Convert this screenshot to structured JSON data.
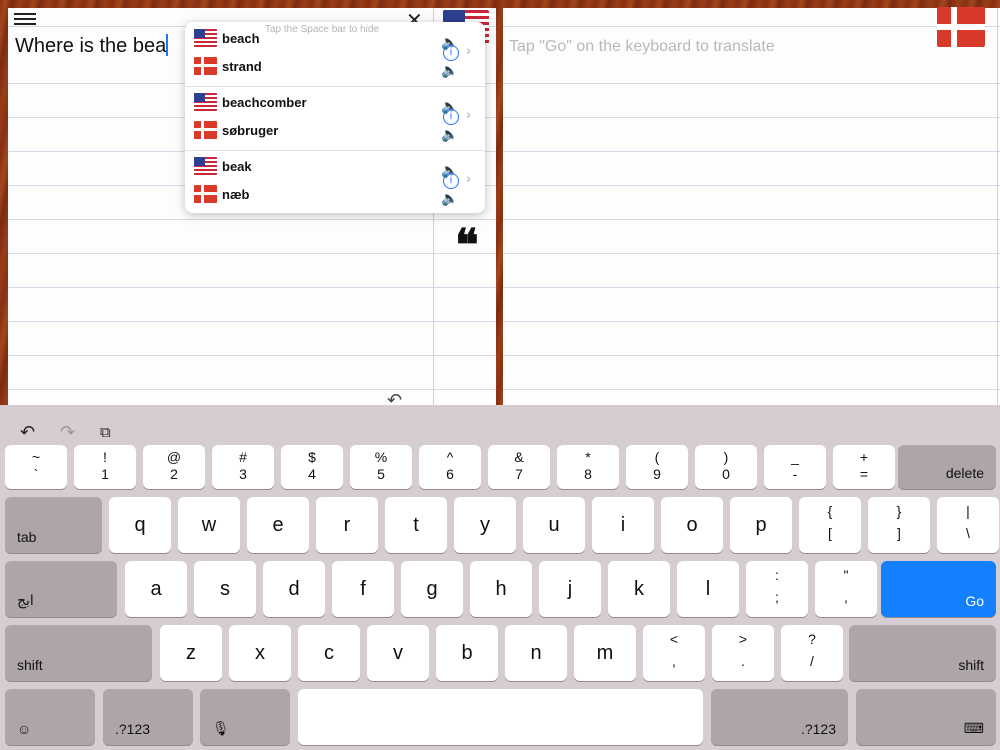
{
  "header": {
    "menu_icon": "hamburger-icon",
    "close_icon": "close-icon"
  },
  "source": {
    "text": "Where is the bea",
    "flag": "us-flag"
  },
  "target": {
    "placeholder": "Tap \"Go\" on the keyboard to translate",
    "flag": "dk-flag"
  },
  "popup": {
    "hint": "Tap the Space bar to hide",
    "suggestions": [
      {
        "en": "beach",
        "da": "strand"
      },
      {
        "en": "beachcomber",
        "da": "søbruger"
      },
      {
        "en": "beak",
        "da": "næb"
      }
    ]
  },
  "keyboard": {
    "row1": [
      {
        "top": "~",
        "bottom": "`"
      },
      {
        "top": "!",
        "bottom": "1"
      },
      {
        "top": "@",
        "bottom": "2"
      },
      {
        "top": "#",
        "bottom": "3"
      },
      {
        "top": "$",
        "bottom": "4"
      },
      {
        "top": "%",
        "bottom": "5"
      },
      {
        "top": "^",
        "bottom": "6"
      },
      {
        "top": "&",
        "bottom": "7"
      },
      {
        "top": "*",
        "bottom": "8"
      },
      {
        "top": "(",
        "bottom": "9"
      },
      {
        "top": ")",
        "bottom": "0"
      },
      {
        "top": "_",
        "bottom": "-"
      },
      {
        "top": "+",
        "bottom": "="
      }
    ],
    "delete": "delete",
    "tab": "tab",
    "row2": [
      "q",
      "w",
      "e",
      "r",
      "t",
      "y",
      "u",
      "i",
      "o",
      "p"
    ],
    "row2_sym": [
      {
        "top": "{",
        "bottom": "["
      },
      {
        "top": "}",
        "bottom": "]"
      },
      {
        "top": "|",
        "bottom": "\\"
      }
    ],
    "lang": "ابج",
    "row3": [
      "a",
      "s",
      "d",
      "f",
      "g",
      "h",
      "j",
      "k",
      "l"
    ],
    "row3_sym": [
      {
        "top": ":",
        "bottom": ";"
      },
      {
        "top": "\"",
        "bottom": ","
      }
    ],
    "go": "Go",
    "shift": "shift",
    "row4": [
      "z",
      "x",
      "c",
      "v",
      "b",
      "n",
      "m"
    ],
    "row4_sym": [
      {
        "top": "<",
        "bottom": ","
      },
      {
        "top": ">",
        "bottom": "."
      },
      {
        "top": "?",
        "bottom": "/"
      }
    ],
    "num": ".?123"
  }
}
